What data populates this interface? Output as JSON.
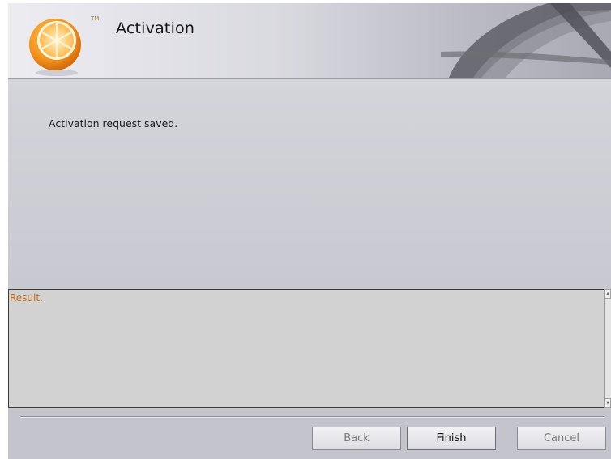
{
  "header": {
    "title": "Activation",
    "trademark": "TM"
  },
  "content": {
    "message": "Activation request saved."
  },
  "result": {
    "text": "Result."
  },
  "buttons": {
    "back": "Back",
    "finish": "Finish",
    "cancel": "Cancel"
  },
  "icons": {
    "logo": "orange-slice-logo-icon",
    "header_decoration": "decorative-swoosh-icon",
    "scroll_up": "scroll-up-arrow-icon",
    "scroll_down": "scroll-down-arrow-icon"
  },
  "colors": {
    "logo_orange": "#f39a1e",
    "result_text": "#c0701a",
    "background": "#c9c9d3"
  }
}
